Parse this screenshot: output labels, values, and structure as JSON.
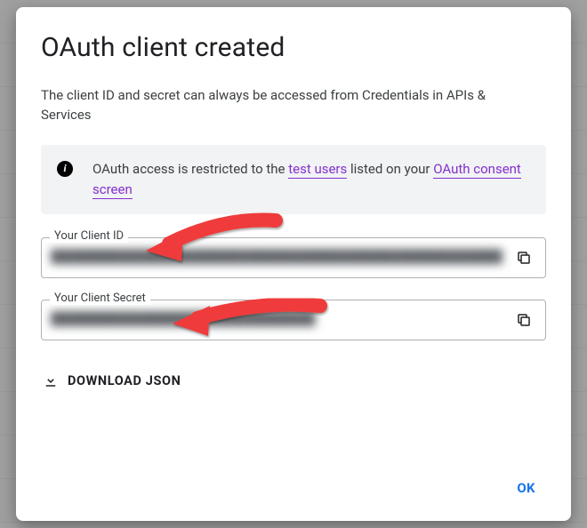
{
  "dialog": {
    "title": "OAuth client created",
    "subtitle": "The client ID and secret can always be accessed from Credentials in APIs & Services",
    "info": {
      "prefix": "OAuth access is restricted to the ",
      "link1": "test users",
      "middle": " listed on your ",
      "link2": "OAuth consent screen"
    },
    "client_id_label": "Your Client ID",
    "client_id_value": "████████████████████████████████████████████████████",
    "client_secret_label": "Your Client Secret",
    "client_secret_value": "██████████████████████████████",
    "download_label": "DOWNLOAD JSON",
    "ok_label": "OK"
  }
}
